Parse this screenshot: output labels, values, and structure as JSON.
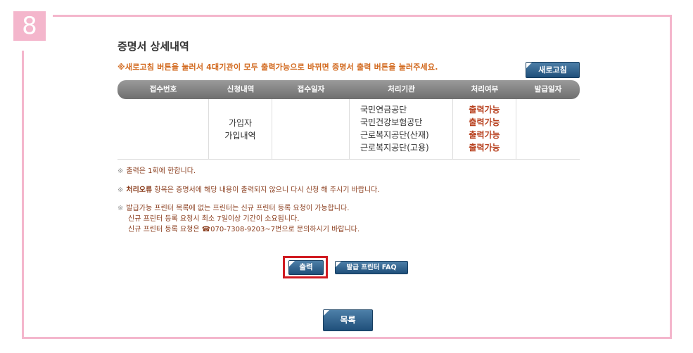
{
  "step_number": "8",
  "page_title": "증명서 상세내역",
  "notice": "※새로고침 버튼을 눌러서 4대기관이 모두 출력가능으로 바뀌면 증명서 출력 버튼을 눌러주세요.",
  "refresh_label": "새로고침",
  "table": {
    "headers": [
      "접수번호",
      "신청내역",
      "접수일자",
      "처리기관",
      "처리여부",
      "발급일자"
    ],
    "row": {
      "receipt_no": "",
      "request": [
        "가입자",
        "가입내역"
      ],
      "receipt_date": "",
      "agencies": [
        "국민연금공단",
        "국민건강보험공단",
        "근로복지공단(산재)",
        "근로복지공단(고용)"
      ],
      "statuses": [
        "출력가능",
        "출력가능",
        "출력가능",
        "출력가능"
      ],
      "issue_date": ""
    }
  },
  "notes": {
    "mark": "※",
    "n1": "출력은 1회에 한합니다.",
    "n2_bold": "처리오류",
    "n2_rest": " 항목은 증명서에 해당 내용이 출력되지 않으니 다시 신청 해 주시기 바랍니다.",
    "n3_line1": "발급가능 프린터 목록에 없는 프린터는 신규 프린터 등록 요청이 가능합니다.",
    "n3_line2": "신규 프린터 등록 요청시 최소 7일이상 기간이 소요됩니다.",
    "n3_line3": "신규 프린터 등록 요청은 ☎070-7308-9203~7번으로 문의하시기 바랍니다."
  },
  "buttons": {
    "print": "출력",
    "printer_faq": "발급 프린터 FAQ",
    "list": "목록"
  }
}
